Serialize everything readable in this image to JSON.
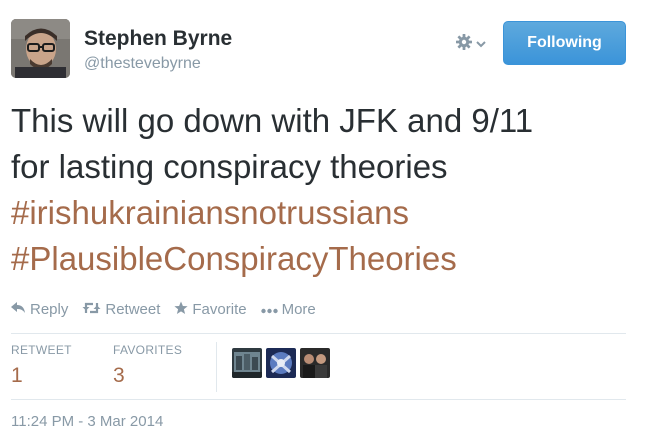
{
  "author": {
    "display_name": "Stephen Byrne",
    "handle": "@thestevebyrne"
  },
  "header": {
    "follow_label": "Following",
    "settings_icon": "gear-icon",
    "dropdown_icon": "chevron-down-icon"
  },
  "tweet": {
    "line1": "This will go down with JFK and 9/11",
    "line2": "for lasting conspiracy theories",
    "hashtags": [
      "#irishukrainiansnotrussians",
      "#PlausibleConspiracyTheories"
    ]
  },
  "actions": [
    {
      "label": "Reply",
      "icon": "reply-icon"
    },
    {
      "label": "Retweet",
      "icon": "retweet-icon"
    },
    {
      "label": "Favorite",
      "icon": "star-icon"
    },
    {
      "label": "More",
      "icon": "more-dots-icon"
    }
  ],
  "stats": {
    "retweets_label": "RETWEET",
    "retweets_count": "1",
    "favorites_label": "FAVORITES",
    "favorites_count": "3"
  },
  "timestamp": "11:24 PM - 3 Mar 2014",
  "colors": {
    "link": "#a56b4b",
    "follow_button": "#3b94d9",
    "muted_text": "#8899a6",
    "primary_text": "#292f33"
  }
}
